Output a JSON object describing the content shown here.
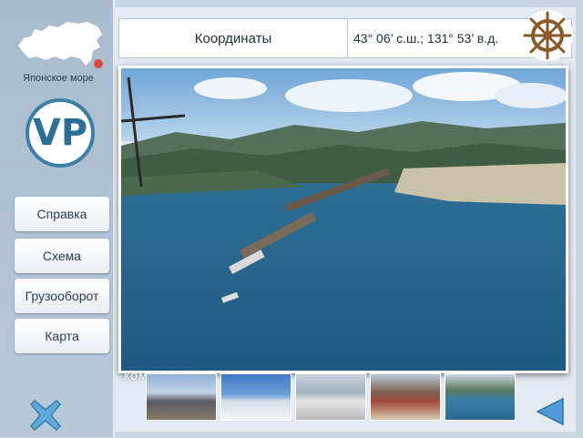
{
  "sidebar": {
    "map_caption": "Японское море",
    "logo_text": "VP",
    "nav": [
      {
        "label": "Справка"
      },
      {
        "label": "Схема"
      },
      {
        "label": "Грузооборот"
      },
      {
        "label": "Карта"
      }
    ]
  },
  "info": {
    "coord_label": "Координаты",
    "coord_value": "43° 06’ с.ш.; 131° 53’ в.д."
  },
  "photo": {
    "caption": "комплекс"
  },
  "thumbnails": [
    {
      "id": "rail-yard"
    },
    {
      "id": "snowy-bay"
    },
    {
      "id": "tanks"
    },
    {
      "id": "coal-train"
    },
    {
      "id": "harbor-aerial"
    }
  ],
  "colors": {
    "accent": "#3b7fa6",
    "marker": "#d64a3a",
    "back_arrow": "#4f9ad6"
  }
}
